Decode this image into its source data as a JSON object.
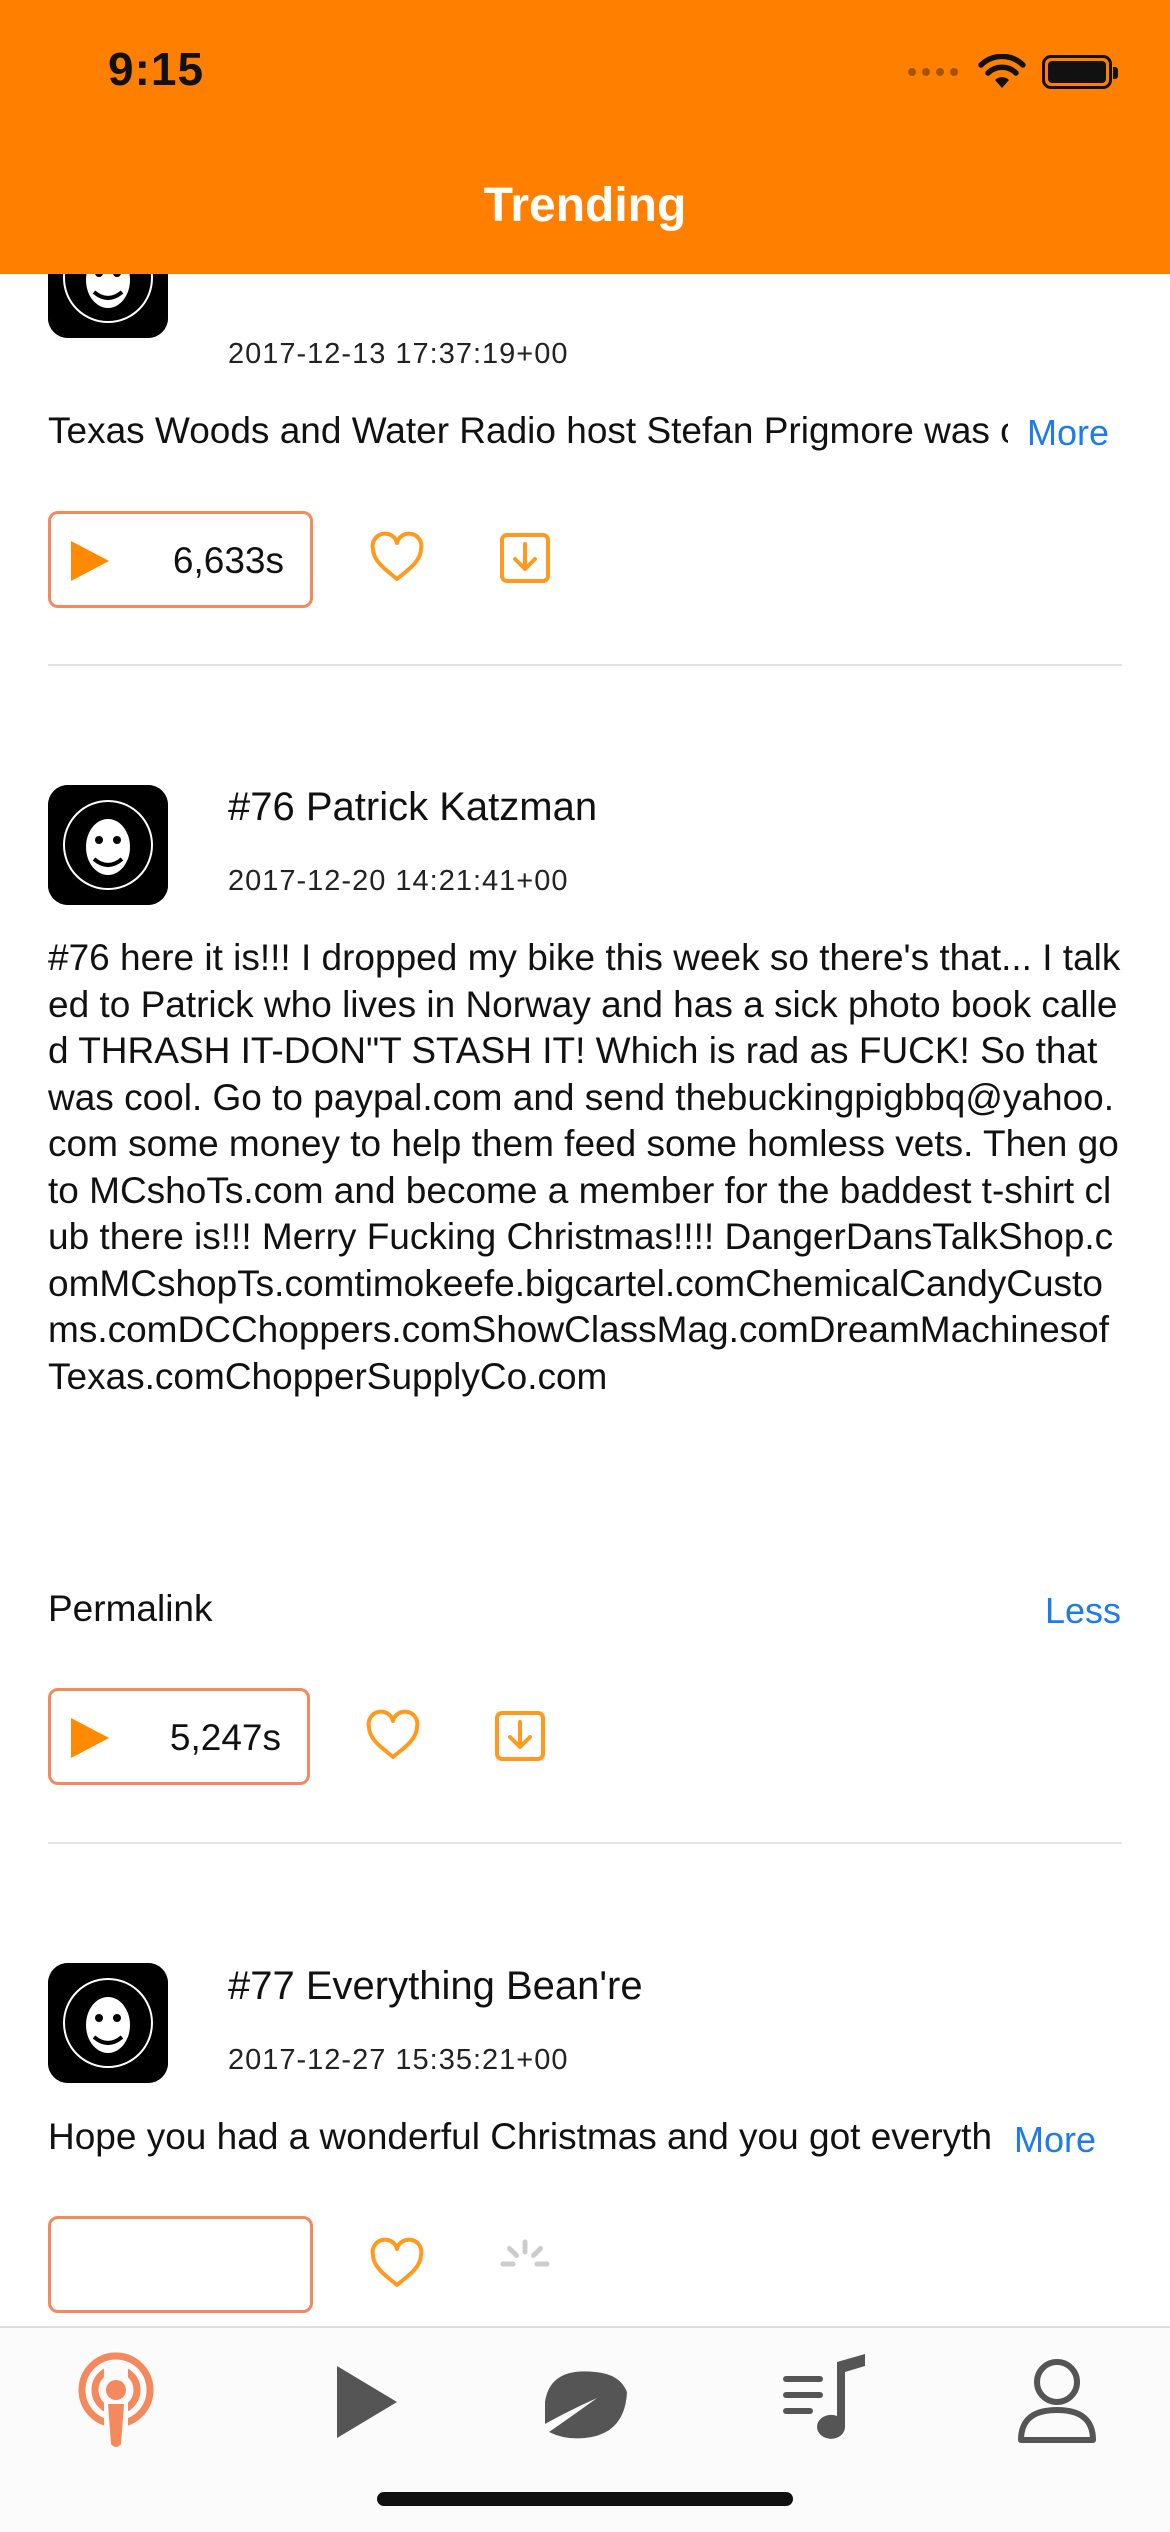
{
  "status_bar": {
    "time": "9:15"
  },
  "header": {
    "title": "Trending"
  },
  "colors": {
    "accent": "#FF8000",
    "link": "#1E7BEA",
    "button_border": "#F5895E",
    "icon_gray": "#555555"
  },
  "episodes": [
    {
      "title": "",
      "date": "2017-12-13 17:37:19+00",
      "description": "Texas Woods and Water Radio host Stefan Prigmore was our guest this week.",
      "toggle_label": "More",
      "duration": "6,633s"
    },
    {
      "title": "#76 Patrick Katzman",
      "date": "2017-12-20 14:21:41+00",
      "description": "#76 here it is!!! I dropped my bike this week so there's that... I talked to Patrick who lives in Norway and has a sick photo book called THRASH IT-DON\"T STASH IT! Which is rad as FUCK! So that was cool. Go to paypal.com and send thebuckingpigbbq@yahoo.com some money to help them feed some homless vets. Then go to MCshoTs.com and become a member for the baddest t-shirt club there is!!! Merry Fucking Christmas!!!!",
      "links": "DangerDansTalkShop.comMCshopTs.comtimokeefe.bigcartel.comChemicalCandyCustoms.comDCChoppers.comShowClassMag.comDreamMachinesofTexas.comChopperSupplyCo.com",
      "permalink_label": "Permalink",
      "toggle_label": "Less",
      "duration": "5,247s"
    },
    {
      "title": "#77 Everything Bean're",
      "date": "2017-12-27 15:35:21+00",
      "description": "Hope you had a wonderful Christmas and you got everything you wanted.",
      "toggle_label": "More"
    }
  ],
  "tabs": [
    {
      "icon": "podcast-icon",
      "active": true
    },
    {
      "icon": "play-icon",
      "active": false
    },
    {
      "icon": "leaf-icon",
      "active": false
    },
    {
      "icon": "playlist-icon",
      "active": false
    },
    {
      "icon": "profile-icon",
      "active": false
    }
  ]
}
